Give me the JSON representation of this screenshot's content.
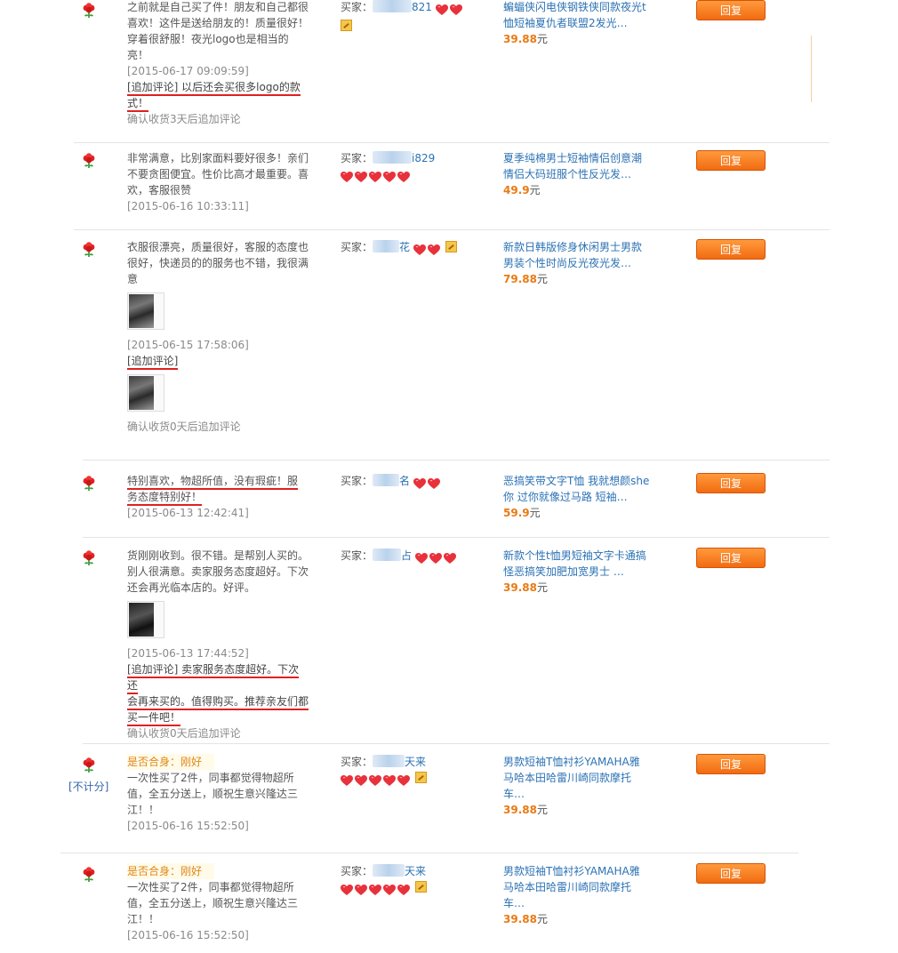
{
  "reply_label": "回复",
  "buyer_prefix": "买家：",
  "price_unit": "元",
  "colors": {
    "accent": "#f26b11",
    "link": "#2c72b4",
    "price": "#e97a12",
    "underline": "#e02020"
  },
  "icons": {
    "flower": "red-flower-icon",
    "heart": "red-heart-icon",
    "vip": "vip-badge-icon"
  },
  "reviews": [
    {
      "comment": "之前就是自己买了件！朋友和自己都很喜欢！这件是送给朋友的！质量很好！穿着很舒服！夜光logo也是相当的亮！",
      "time": "[2015-06-17 09:09:59]",
      "add_comment_line1": "[追加评论] 以后还会买很多logo的款",
      "add_comment_line2": "式！",
      "confirm": "确认收货3天后追加评论",
      "buyer_name": "821",
      "product": "蝙蝠侠闪电侠钢铁侠同款夜光t恤短袖夏仇者联盟2发光…",
      "price": "39.88"
    },
    {
      "comment": "非常满意，比别家面料要好很多！亲们不要贪图便宜。性价比高才最重要。喜欢，客服很赞",
      "time": "[2015-06-16 10:33:11]",
      "buyer_name": "i829",
      "product": "夏季纯棉男士短袖情侣创意潮情侣大码班服个性反光发…",
      "price": "49.9"
    },
    {
      "comment": "衣服很漂亮，质量很好，客服的态度也很好，快递员的的服务也不错，我很满意",
      "time": "[2015-06-15 17:58:06]",
      "add_label": "[追加评论]",
      "confirm": "确认收货0天后追加评论",
      "buyer_name": "花",
      "product": "新款日韩版修身休闲男士男款男装个性时尚反光夜光发…",
      "price": "79.88"
    },
    {
      "comment_line1": "特别喜欢，物超所值，没有瑕疵！服",
      "comment_line2": "务态度特别好！",
      "time": "[2015-06-13 12:42:41]",
      "buyer_name": "名",
      "product": "恶搞笑带文字T恤 我就想颜she你 过你就像过马路 短袖…",
      "price": "59.9"
    },
    {
      "comment": "货刚刚收到。很不错。是帮别人买的。别人很满意。卖家服务态度超好。下次还会再光临本店的。好评。",
      "time": "[2015-06-13 17:44:52]",
      "add_line1": "[追加评论] 卖家服务态度超好。下次还",
      "add_line2": "会再来买的。值得购买。推荐亲友们都",
      "add_line3": "买一件吧！",
      "confirm": "确认收货0天后追加评论",
      "buyer_name": "占",
      "product": "新款个性t恤男短袖文字卡通搞怪恶搞笑加肥加宽男士 …",
      "price": "39.88"
    },
    {
      "fit": "是否合身：刚好",
      "not_counted": "[不计分]",
      "comment": "一次性买了2件，同事都觉得物超所值，全五分送上，顺祝生意兴隆达三江！！",
      "time": "[2015-06-16 15:52:50]",
      "buyer_name": "天来",
      "product": "男款短袖T恤衬衫YAMAHA雅马哈本田哈雷川崎同款摩托车…",
      "price": "39.88"
    },
    {
      "fit": "是否合身：刚好",
      "comment": "一次性买了2件，同事都觉得物超所值，全五分送上，顺祝生意兴隆达三江！！",
      "time": "[2015-06-16 15:52:50]",
      "buyer_name": "天来",
      "product": "男款短袖T恤衬衫YAMAHA雅马哈本田哈雷川崎同款摩托车…",
      "price": "39.88"
    }
  ]
}
